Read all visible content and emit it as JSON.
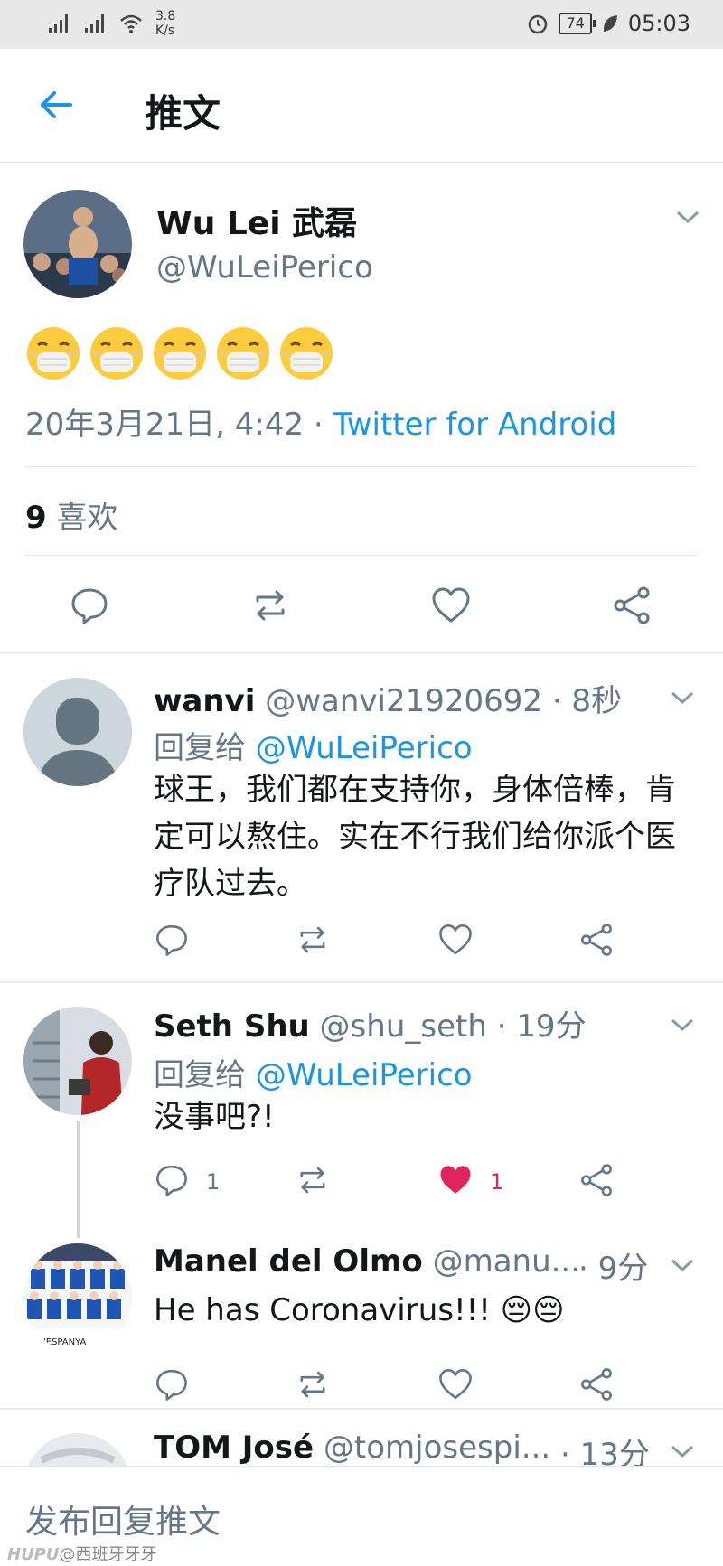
{
  "status_bar": {
    "net_speed": "3.8",
    "net_unit": "K/s",
    "battery": "74",
    "time": "05:03"
  },
  "app_bar": {
    "title": "推文"
  },
  "main_tweet": {
    "name": "Wu Lei 武磊",
    "handle": "@WuLeiPerico",
    "emoji_count": 5,
    "date": "20年3月21日, 4:42 · ",
    "source": "Twitter for Android",
    "likes_count": "9",
    "likes_label": " 喜欢"
  },
  "replies": [
    {
      "name": "wanvi",
      "handle": " @wanvi21920692 · 8秒",
      "reply_to_label": "回复给 ",
      "reply_to": "@WuLeiPerico",
      "text": "球王，我们都在支持你，身体倍棒，肯定可以熬住。实在不行我们给你派个医疗队过去。"
    },
    {
      "name": "Seth Shu",
      "handle": " @shu_seth · 19分",
      "reply_to_label": "回复给 ",
      "reply_to": "@WuLeiPerico",
      "text": "没事吧?!",
      "reply_count": "1",
      "like_count": "1",
      "liked": true
    },
    {
      "name": "Manel del Olmo",
      "handle": " @manu...",
      "time": "· 9分",
      "text": "He has Coronavirus!!! 😔😔"
    },
    {
      "name": "TOM José",
      "handle": " @tomjosespi...",
      "time": "· 13分"
    }
  ],
  "compose": {
    "placeholder": "发布回复推文"
  },
  "watermark": {
    "brand": "HUPU",
    "text": "@西班牙牙牙"
  },
  "colors": {
    "accent": "#1b95e0",
    "like": "#e0245e",
    "muted": "#657786"
  }
}
